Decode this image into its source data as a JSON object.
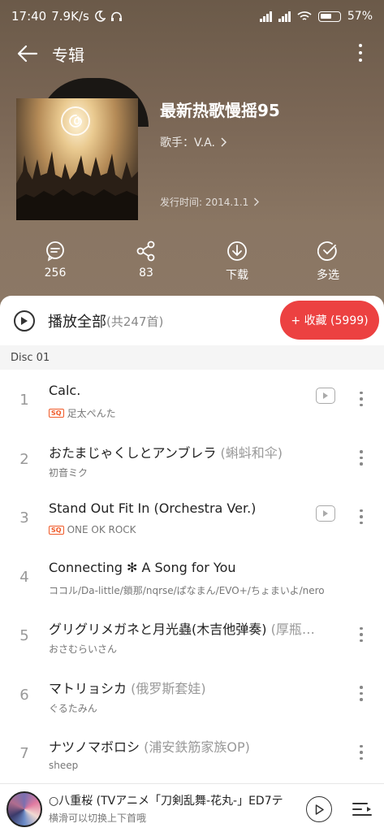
{
  "status": {
    "time": "17:40",
    "speed": "7.9K/s",
    "battery": "57",
    "battery_unit": "%"
  },
  "header": {
    "title": "专辑"
  },
  "album": {
    "title": "最新热歌慢摇95",
    "singer_label": "歌手：V.A.",
    "release": "发行时间: 2014.1.1"
  },
  "actions": [
    {
      "label": "256",
      "icon": "comment-icon"
    },
    {
      "label": "83",
      "icon": "share-icon"
    },
    {
      "label": "下载",
      "icon": "download-icon"
    },
    {
      "label": "多选",
      "icon": "multiselect-icon"
    }
  ],
  "playall": {
    "label": "播放全部",
    "count": "(共247首)",
    "collect": "+ 收藏 (5999)"
  },
  "disc_label": "Disc 01",
  "tracks": [
    {
      "num": "1",
      "title": "Calc.",
      "sub": "",
      "artist": "足太ぺんた",
      "sq": true,
      "mv": true
    },
    {
      "num": "2",
      "title": "おたまじゃくしとアンブレラ",
      "sub": " (蝌蚪和伞)",
      "artist": "初音ミク",
      "sq": false,
      "mv": false
    },
    {
      "num": "3",
      "title": "Stand Out Fit In (Orchestra Ver.)",
      "sub": "",
      "artist": "ONE OK ROCK",
      "sq": true,
      "mv": true
    },
    {
      "num": "4",
      "title": "Connecting ✻ A Song for You",
      "sub": "",
      "artist": "ココル/Da-little/鎖那/nqrse/ぱなまん/EVO+/ちょまいよ/nero",
      "sq": false,
      "mv": false
    },
    {
      "num": "5",
      "title": "グリグリメガネと月光蟲(木吉他弹奏)",
      "sub": " (厚瓶…",
      "artist": "おさむらいさん",
      "sq": false,
      "mv": false
    },
    {
      "num": "6",
      "title": "マトリョシカ",
      "sub": " (俄罗斯套娃)",
      "artist": "ぐるたみん",
      "sq": false,
      "mv": false
    },
    {
      "num": "7",
      "title": "ナツノマボロシ",
      "sub": " (浦安鉄筋家族OP)",
      "artist": "sheep",
      "sq": false,
      "mv": false
    }
  ],
  "sq_badge": "SQ",
  "player": {
    "title": "○八重桜 (TVアニメ「刀剣乱舞-花丸-」ED7テ",
    "subtitle": "横滑可以切换上下首哦"
  }
}
